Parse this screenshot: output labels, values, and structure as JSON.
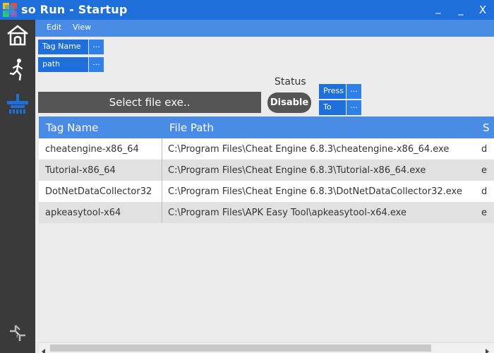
{
  "window": {
    "title": "so Run - Startup",
    "minimize": "_",
    "maximize": "_",
    "close": "X"
  },
  "menu": {
    "edit": "Edit",
    "view": "View"
  },
  "sidebar": {
    "items": [
      {
        "name": "home",
        "icon": "home-icon"
      },
      {
        "name": "run",
        "icon": "running-person-icon"
      },
      {
        "name": "startup",
        "icon": "startup-icon"
      },
      {
        "name": "help",
        "icon": "help-puzzle-icon"
      }
    ]
  },
  "fields": {
    "tag_name_label": "Tag Name",
    "tag_name_button": "...",
    "path_label": "path",
    "path_button": "...",
    "select_file": "Select file exe..",
    "status_label": "Status",
    "disable_button": "Disable",
    "press_label": "Press",
    "press_button": "...",
    "to_label": "To",
    "to_button": "..."
  },
  "table": {
    "columns": [
      "Tag Name",
      "File Path",
      "S"
    ],
    "rows": [
      {
        "tag": "cheatengine-x86_64",
        "path": "C:\\Program Files\\Cheat Engine 6.8.3\\cheatengine-x86_64.exe",
        "extra": "d"
      },
      {
        "tag": "Tutorial-x86_64",
        "path": "C:\\Program Files\\Cheat Engine 6.8.3\\Tutorial-x86_64.exe",
        "extra": "e"
      },
      {
        "tag": "DotNetDataCollector32",
        "path": "C:\\Program Files\\Cheat Engine 6.8.3\\DotNetDataCollector32.exe",
        "extra": "d"
      },
      {
        "tag": "apkeasytool-x64",
        "path": "C:\\Program Files\\APK Easy Tool\\apkeasytool-x64.exe",
        "extra": "e"
      }
    ]
  },
  "colors": {
    "titlebar": "#1e6fd9",
    "menubar": "#4a8be6",
    "sidebar": "#3a3a3a",
    "button_dark": "#555555"
  }
}
